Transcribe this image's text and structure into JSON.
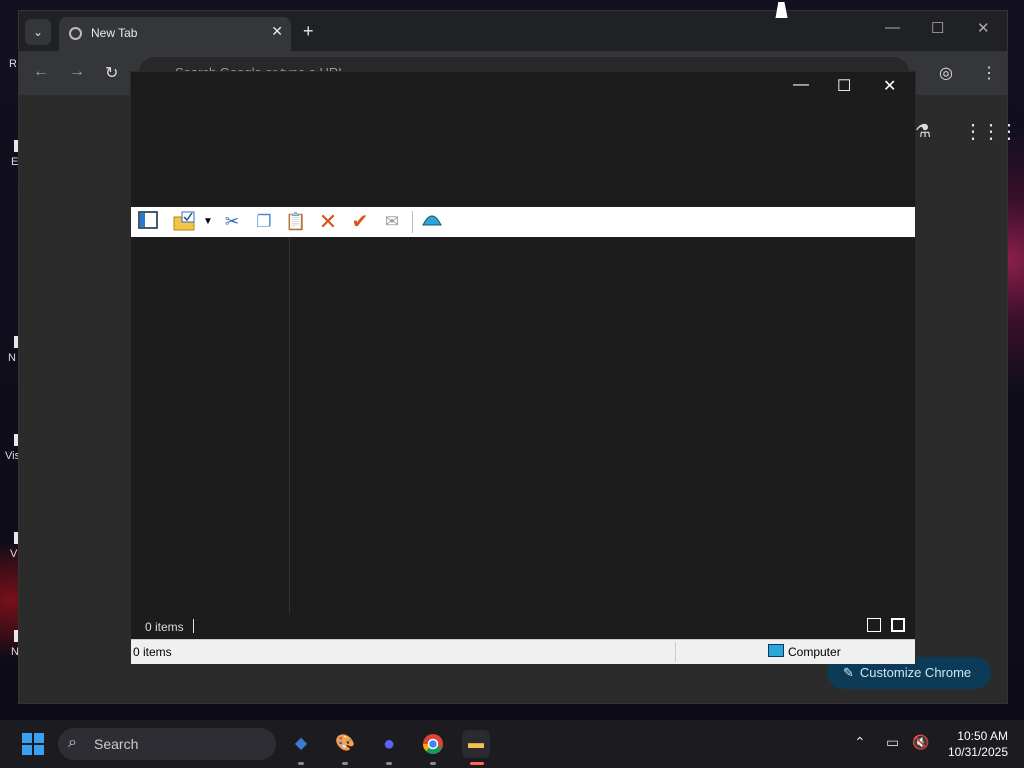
{
  "chrome": {
    "tab_title": "New Tab",
    "tab_close": "✕",
    "new_tab": "+",
    "omnibox_placeholder": "Search Google or type a URL",
    "customize_label": "Customize Chrome",
    "minimize": "—",
    "maximize": "☐",
    "close": "✕"
  },
  "explorer": {
    "minimize": "—",
    "maximize": "☐",
    "close": "✕",
    "toolbar_icons": [
      "panel-icon",
      "folder-check-icon",
      "dropdown-icon",
      "cut-icon",
      "copy-icon",
      "paste-icon",
      "delete-icon",
      "check-icon",
      "mail-icon",
      "shell-icon"
    ],
    "status_top_items": "0 items",
    "status_bottom_items": "0 items",
    "status_location": "Computer"
  },
  "taskbar": {
    "search_label": "Search",
    "time": "10:50 AM",
    "date": "10/31/2025"
  },
  "desktop_icons": [
    "R",
    "E",
    "N",
    "Vis",
    "V",
    "N"
  ],
  "colors": {
    "accent": "#3aa0f2",
    "customize_bg": "#0b3b57",
    "chrome_dark": "#202124"
  }
}
